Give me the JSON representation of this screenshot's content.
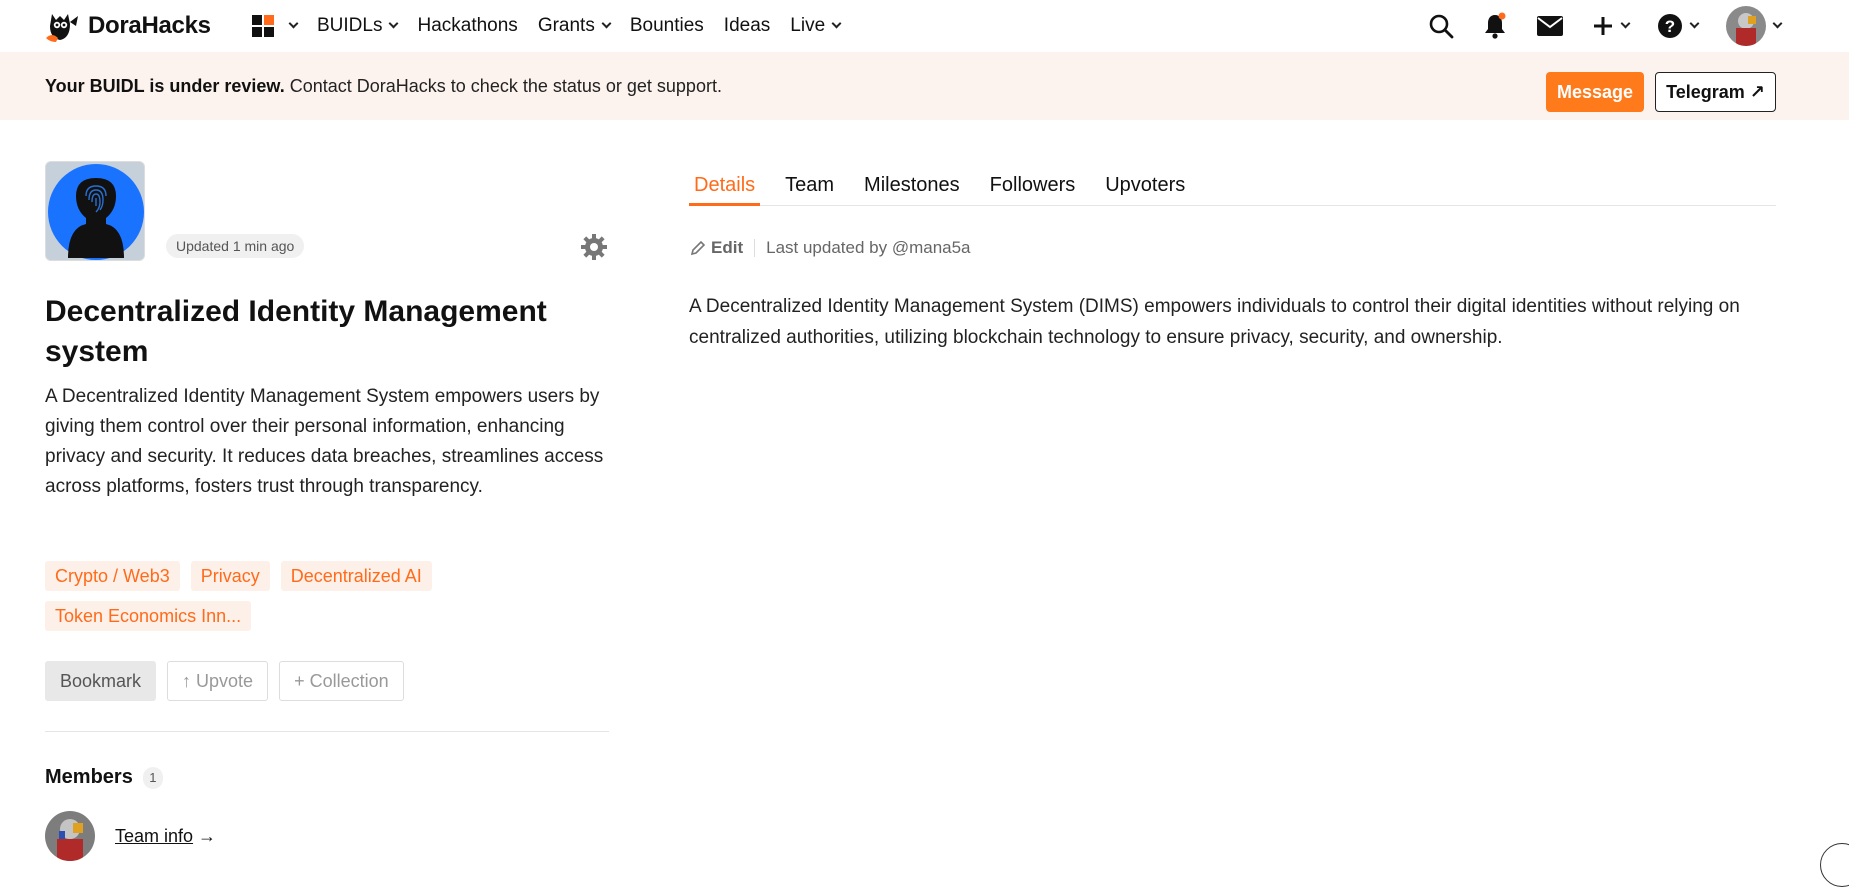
{
  "nav": {
    "brand": "DoraHacks",
    "items": [
      {
        "label": "BUIDLs",
        "has_dropdown": true
      },
      {
        "label": "Hackathons",
        "has_dropdown": false
      },
      {
        "label": "Grants",
        "has_dropdown": true
      },
      {
        "label": "Bounties",
        "has_dropdown": false
      },
      {
        "label": "Ideas",
        "has_dropdown": false
      },
      {
        "label": "Live",
        "has_dropdown": true
      }
    ],
    "icons": [
      "apps-grid-icon",
      "search-icon",
      "bell-icon",
      "mail-icon",
      "plus-icon",
      "help-icon",
      "avatar"
    ],
    "notification_dot_color": "#ff6b1a"
  },
  "banner": {
    "bold": "Your BUIDL is under review.",
    "text": " Contact DoraHacks to check the status or get support.",
    "message_button": "Message",
    "telegram_button": "Telegram ↗"
  },
  "project": {
    "updated": "Updated 1 min ago",
    "title": "Decentralized Identity Management system",
    "description": "A Decentralized Identity Management System empowers users by giving them control over their personal information, enhancing privacy and security. It reduces data breaches, streamlines access across platforms, fosters trust through transparency.",
    "tags": [
      "Crypto / Web3",
      "Privacy",
      "Decentralized AI",
      "Token Economics Inn..."
    ],
    "actions": {
      "bookmark": "Bookmark",
      "upvote": "↑ Upvote",
      "collection": "+ Collection"
    },
    "members": {
      "title": "Members",
      "count": "1",
      "team_info": "Team info",
      "arrow": " →"
    }
  },
  "tabs": [
    "Details",
    "Team",
    "Milestones",
    "Followers",
    "Upvoters"
  ],
  "active_tab": "Details",
  "details": {
    "edit": "Edit",
    "last_updated": "Last updated by @mana5a",
    "body": "A Decentralized Identity Management System (DIMS) empowers individuals to control their digital identities without relying on centralized authorities, utilizing blockchain technology to ensure privacy, security, and ownership."
  },
  "colors": {
    "accent": "#ff6b1a",
    "banner_bg": "#fdf3ee",
    "tag_bg": "#fdf0e8"
  }
}
